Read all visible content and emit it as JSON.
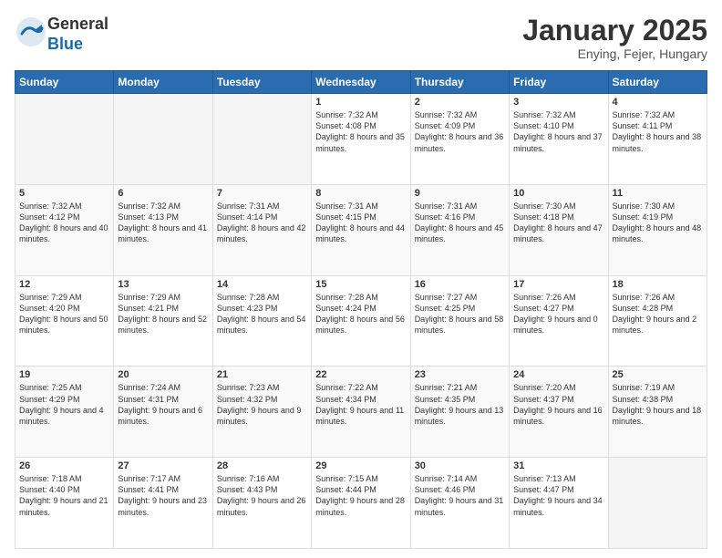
{
  "logo": {
    "general": "General",
    "blue": "Blue"
  },
  "header": {
    "title": "January 2025",
    "subtitle": "Enying, Fejer, Hungary"
  },
  "weekdays": [
    "Sunday",
    "Monday",
    "Tuesday",
    "Wednesday",
    "Thursday",
    "Friday",
    "Saturday"
  ],
  "weeks": [
    [
      {
        "day": "",
        "info": ""
      },
      {
        "day": "",
        "info": ""
      },
      {
        "day": "",
        "info": ""
      },
      {
        "day": "1",
        "info": "Sunrise: 7:32 AM\nSunset: 4:08 PM\nDaylight: 8 hours and 35 minutes."
      },
      {
        "day": "2",
        "info": "Sunrise: 7:32 AM\nSunset: 4:09 PM\nDaylight: 8 hours and 36 minutes."
      },
      {
        "day": "3",
        "info": "Sunrise: 7:32 AM\nSunset: 4:10 PM\nDaylight: 8 hours and 37 minutes."
      },
      {
        "day": "4",
        "info": "Sunrise: 7:32 AM\nSunset: 4:11 PM\nDaylight: 8 hours and 38 minutes."
      }
    ],
    [
      {
        "day": "5",
        "info": "Sunrise: 7:32 AM\nSunset: 4:12 PM\nDaylight: 8 hours and 40 minutes."
      },
      {
        "day": "6",
        "info": "Sunrise: 7:32 AM\nSunset: 4:13 PM\nDaylight: 8 hours and 41 minutes."
      },
      {
        "day": "7",
        "info": "Sunrise: 7:31 AM\nSunset: 4:14 PM\nDaylight: 8 hours and 42 minutes."
      },
      {
        "day": "8",
        "info": "Sunrise: 7:31 AM\nSunset: 4:15 PM\nDaylight: 8 hours and 44 minutes."
      },
      {
        "day": "9",
        "info": "Sunrise: 7:31 AM\nSunset: 4:16 PM\nDaylight: 8 hours and 45 minutes."
      },
      {
        "day": "10",
        "info": "Sunrise: 7:30 AM\nSunset: 4:18 PM\nDaylight: 8 hours and 47 minutes."
      },
      {
        "day": "11",
        "info": "Sunrise: 7:30 AM\nSunset: 4:19 PM\nDaylight: 8 hours and 48 minutes."
      }
    ],
    [
      {
        "day": "12",
        "info": "Sunrise: 7:29 AM\nSunset: 4:20 PM\nDaylight: 8 hours and 50 minutes."
      },
      {
        "day": "13",
        "info": "Sunrise: 7:29 AM\nSunset: 4:21 PM\nDaylight: 8 hours and 52 minutes."
      },
      {
        "day": "14",
        "info": "Sunrise: 7:28 AM\nSunset: 4:23 PM\nDaylight: 8 hours and 54 minutes."
      },
      {
        "day": "15",
        "info": "Sunrise: 7:28 AM\nSunset: 4:24 PM\nDaylight: 8 hours and 56 minutes."
      },
      {
        "day": "16",
        "info": "Sunrise: 7:27 AM\nSunset: 4:25 PM\nDaylight: 8 hours and 58 minutes."
      },
      {
        "day": "17",
        "info": "Sunrise: 7:26 AM\nSunset: 4:27 PM\nDaylight: 9 hours and 0 minutes."
      },
      {
        "day": "18",
        "info": "Sunrise: 7:26 AM\nSunset: 4:28 PM\nDaylight: 9 hours and 2 minutes."
      }
    ],
    [
      {
        "day": "19",
        "info": "Sunrise: 7:25 AM\nSunset: 4:29 PM\nDaylight: 9 hours and 4 minutes."
      },
      {
        "day": "20",
        "info": "Sunrise: 7:24 AM\nSunset: 4:31 PM\nDaylight: 9 hours and 6 minutes."
      },
      {
        "day": "21",
        "info": "Sunrise: 7:23 AM\nSunset: 4:32 PM\nDaylight: 9 hours and 9 minutes."
      },
      {
        "day": "22",
        "info": "Sunrise: 7:22 AM\nSunset: 4:34 PM\nDaylight: 9 hours and 11 minutes."
      },
      {
        "day": "23",
        "info": "Sunrise: 7:21 AM\nSunset: 4:35 PM\nDaylight: 9 hours and 13 minutes."
      },
      {
        "day": "24",
        "info": "Sunrise: 7:20 AM\nSunset: 4:37 PM\nDaylight: 9 hours and 16 minutes."
      },
      {
        "day": "25",
        "info": "Sunrise: 7:19 AM\nSunset: 4:38 PM\nDaylight: 9 hours and 18 minutes."
      }
    ],
    [
      {
        "day": "26",
        "info": "Sunrise: 7:18 AM\nSunset: 4:40 PM\nDaylight: 9 hours and 21 minutes."
      },
      {
        "day": "27",
        "info": "Sunrise: 7:17 AM\nSunset: 4:41 PM\nDaylight: 9 hours and 23 minutes."
      },
      {
        "day": "28",
        "info": "Sunrise: 7:16 AM\nSunset: 4:43 PM\nDaylight: 9 hours and 26 minutes."
      },
      {
        "day": "29",
        "info": "Sunrise: 7:15 AM\nSunset: 4:44 PM\nDaylight: 9 hours and 28 minutes."
      },
      {
        "day": "30",
        "info": "Sunrise: 7:14 AM\nSunset: 4:46 PM\nDaylight: 9 hours and 31 minutes."
      },
      {
        "day": "31",
        "info": "Sunrise: 7:13 AM\nSunset: 4:47 PM\nDaylight: 9 hours and 34 minutes."
      },
      {
        "day": "",
        "info": ""
      }
    ]
  ]
}
